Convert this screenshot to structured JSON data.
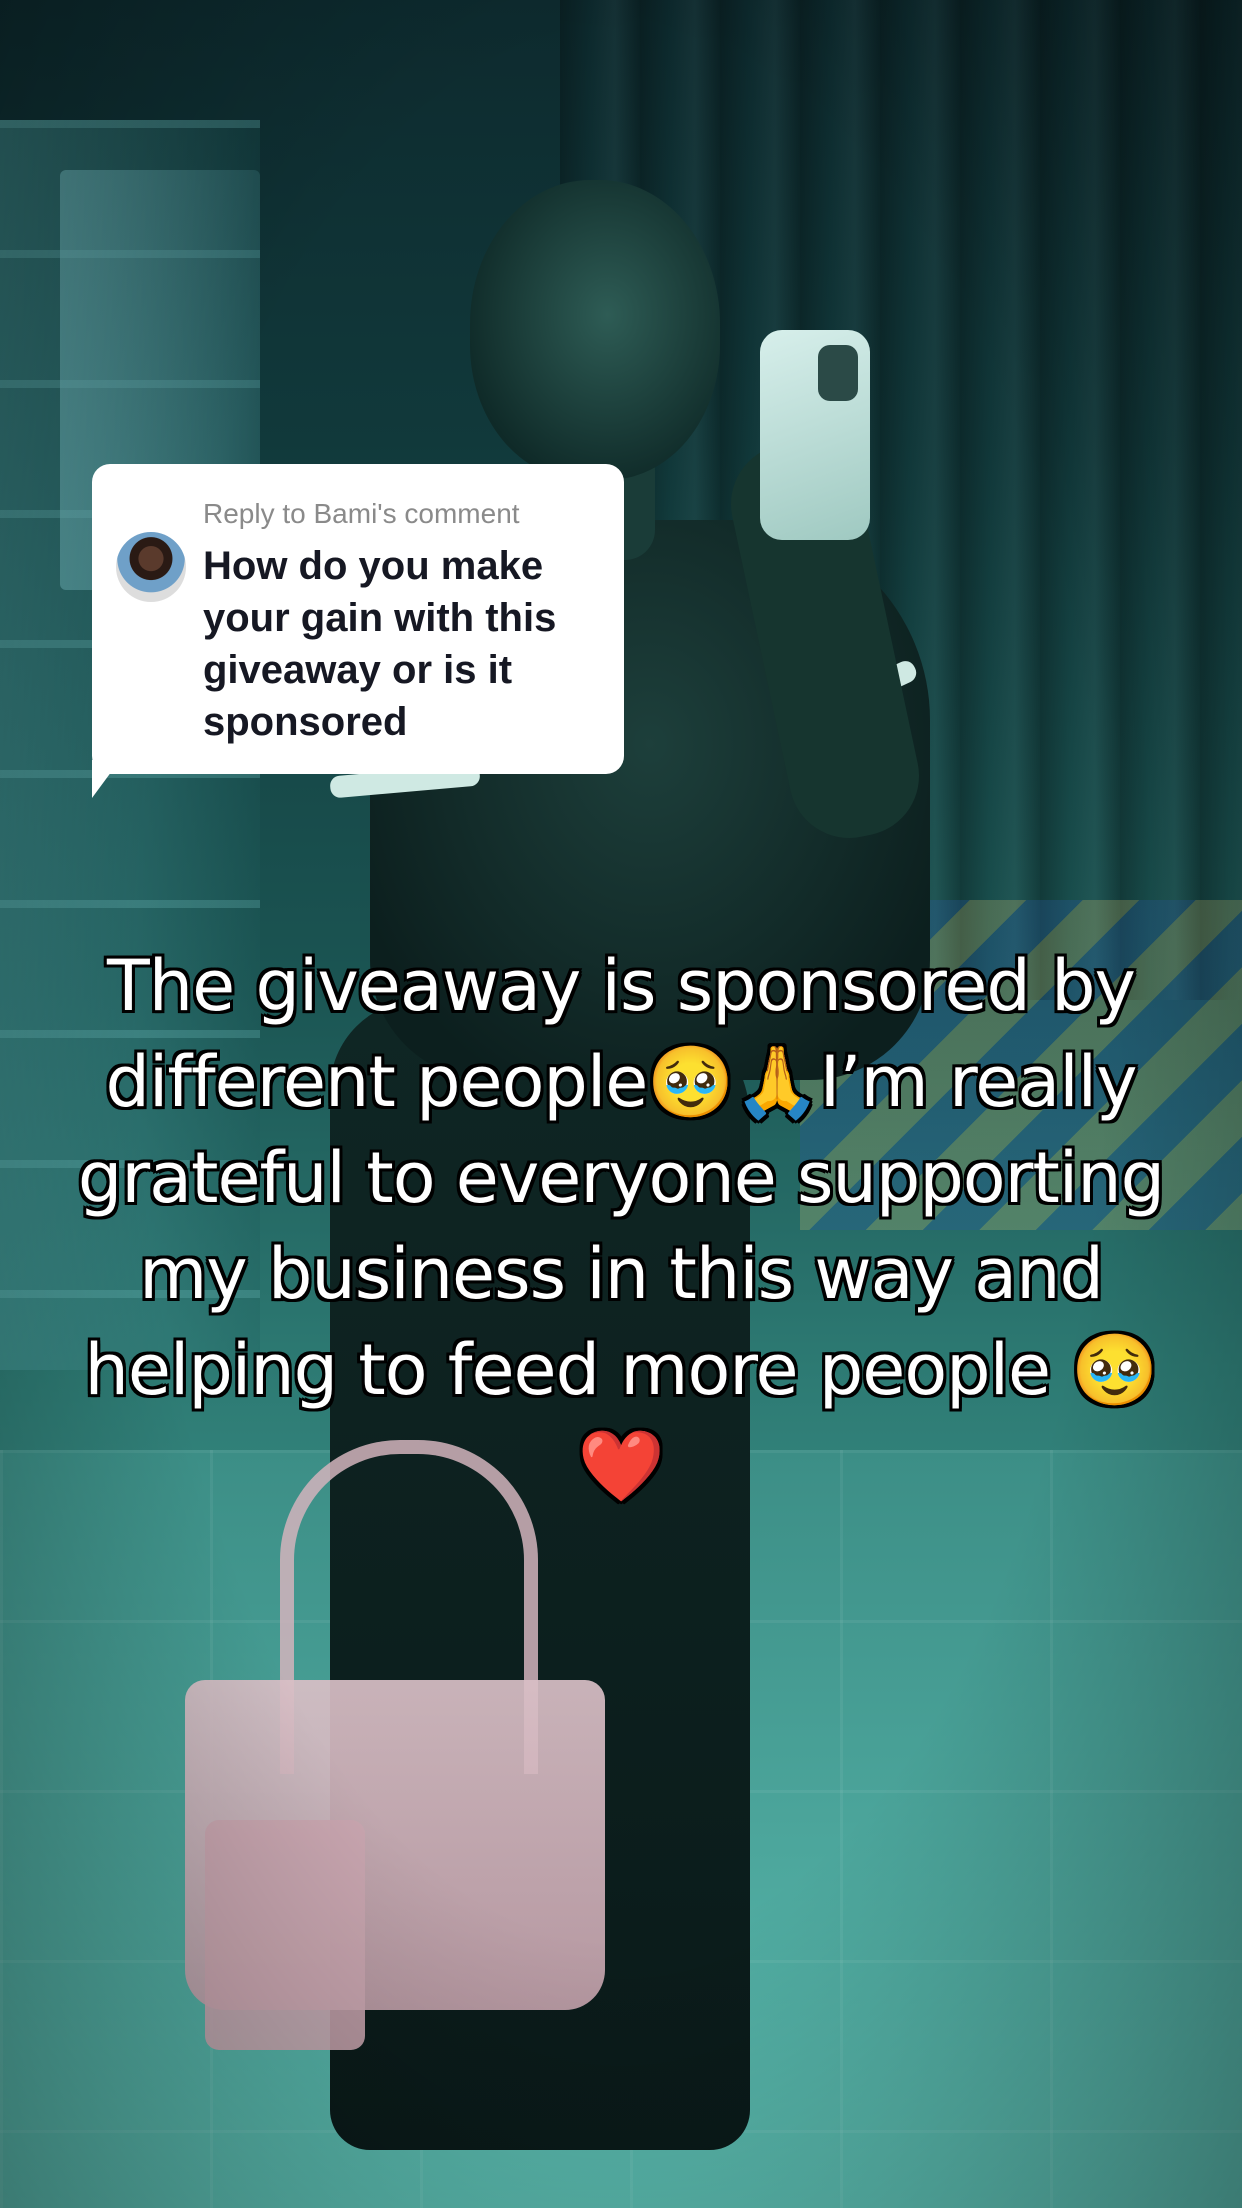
{
  "reply": {
    "label": "Reply to Bami's comment",
    "text": "How do you make your gain with this giveaway or is it sponsored"
  },
  "caption": {
    "text": "The giveaway is sponsored by different people🥹🙏I’m really grateful to everyone supporting my business in this way and helping to feed more people 🥹❤️"
  }
}
